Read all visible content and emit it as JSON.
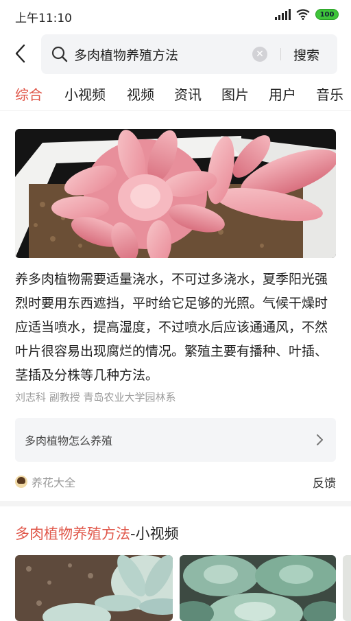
{
  "status": {
    "time": "上午11:10",
    "battery": "100"
  },
  "search": {
    "query": "多肉植物养殖方法",
    "button_label": "搜索"
  },
  "tabs": [
    {
      "label": "综合",
      "active": true
    },
    {
      "label": "小视频",
      "active": false
    },
    {
      "label": "视频",
      "active": false
    },
    {
      "label": "资讯",
      "active": false
    },
    {
      "label": "图片",
      "active": false
    },
    {
      "label": "用户",
      "active": false
    },
    {
      "label": "音乐",
      "active": false
    }
  ],
  "answer_card": {
    "text": "养多肉植物需要适量浇水，不可过多浇水，夏季阳光强烈时要用东西遮挡，平时给它足够的光照。气候干燥时应适当喷水，提高湿度，不过喷水后应该通通风，不然叶片很容易出现腐烂的情况。繁殖主要有播种、叶插、茎插及分株等几种方法。",
    "source": "刘志科 副教授 青岛农业大学园林系",
    "related_question": "多肉植物怎么养殖",
    "origin_label": "养花大全",
    "feedback_label": "反馈"
  },
  "video_section": {
    "title_highlight": "多肉植物养殖方法",
    "title_rest": "-小视频"
  },
  "colors": {
    "accent": "#e0574a",
    "muted": "#9a9a9a",
    "search_bg": "#f3f4f6"
  },
  "icons": [
    "back-arrow-icon",
    "search-icon",
    "clear-icon",
    "chevron-right-icon",
    "wifi-icon",
    "signal-icon",
    "battery-icon"
  ]
}
